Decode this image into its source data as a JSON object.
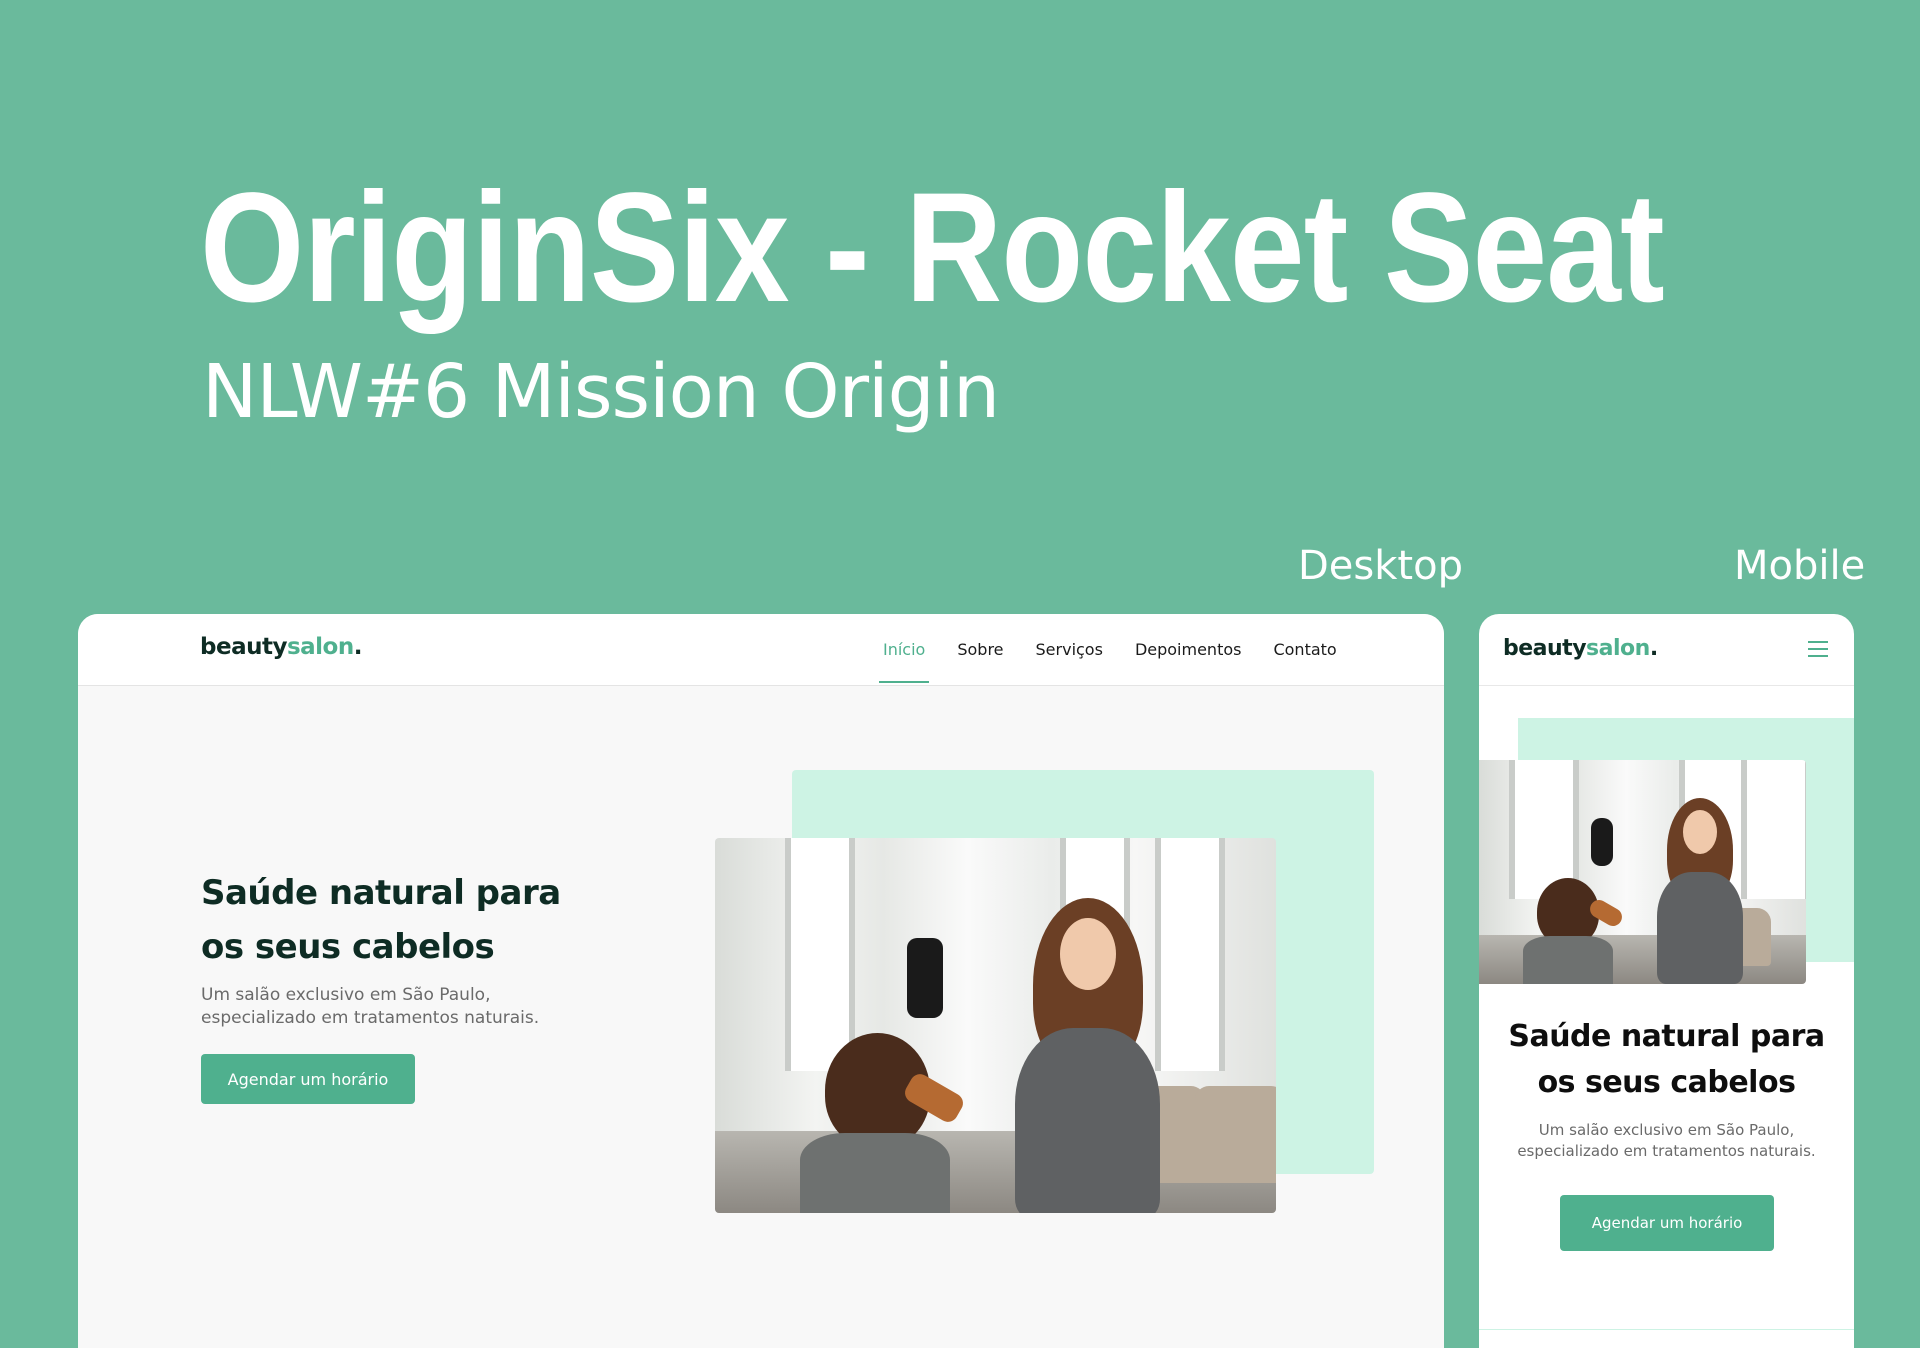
{
  "banner": {
    "title": "OriginSix - Rocket Seat",
    "subtitle": "NLW#6 Mission Origin",
    "desktop_label": "Desktop",
    "mobile_label": "Mobile"
  },
  "site": {
    "logo_main": "beauty",
    "logo_accent": "salon",
    "logo_dot": ".",
    "nav": [
      "Início",
      "Sobre",
      "Serviços",
      "Depoimentos",
      "Contato"
    ],
    "active_nav": "Início",
    "headline_line1": "Saúde natural para",
    "headline_line2": "os seus cabelos",
    "description_line1": "Um salão exclusivo em São Paulo,",
    "description_line2": "especializado em tratamentos naturais.",
    "cta_label": "Agendar um horário"
  },
  "colors": {
    "background": "#6aba9c",
    "accent": "#4fb08e",
    "mint": "#cdf3e4",
    "heading": "#0e2c24"
  },
  "icons": {
    "menu": "hamburger-menu-icon"
  }
}
